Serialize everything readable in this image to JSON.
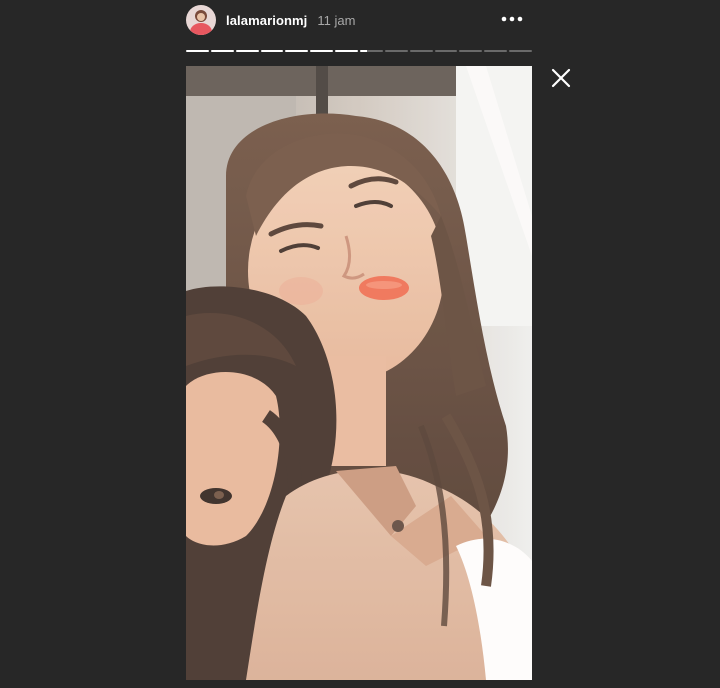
{
  "story": {
    "username": "lalamarionmj",
    "timestamp": "11 jam",
    "progress": {
      "segments_total": 14,
      "segments_completed": 7,
      "current_segment_fill": 0.3
    }
  },
  "icons": {
    "more": "more-options-icon",
    "close": "close-icon",
    "avatar": "avatar"
  },
  "colors": {
    "background": "#272727",
    "text_primary": "#ffffff",
    "text_secondary": "#a8a8a8",
    "progress_active": "#ffffff",
    "progress_inactive": "#6a6a6a"
  }
}
